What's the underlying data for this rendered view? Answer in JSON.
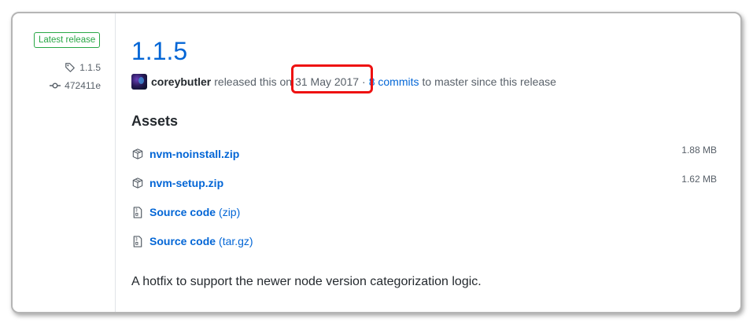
{
  "release": {
    "badge": "Latest release",
    "tag": "1.1.5",
    "commit": "472411e",
    "title": "1.1.5",
    "author": "coreybutler",
    "released_text": "released this on",
    "date": "31 May 2017",
    "separator": "·",
    "commits_link": "8 commits",
    "commits_suffix": "to master since this release"
  },
  "assets": {
    "heading": "Assets",
    "items": [
      {
        "name": "nvm-noinstall.zip",
        "ext": "",
        "size": "1.88 MB",
        "icon": "package-icon"
      },
      {
        "name": "nvm-setup.zip",
        "ext": "",
        "size": "1.62 MB",
        "icon": "package-icon"
      },
      {
        "name": "Source code",
        "ext": "(zip)",
        "size": "",
        "icon": "file-zip-icon"
      },
      {
        "name": "Source code",
        "ext": "(tar.gz)",
        "size": "",
        "icon": "file-zip-icon"
      }
    ]
  },
  "description": "A hotfix to support the newer node version categorization logic.",
  "colors": {
    "link": "#0366d6",
    "badge_green": "#28a745",
    "highlight_red": "#ee1111",
    "muted": "#586069"
  }
}
